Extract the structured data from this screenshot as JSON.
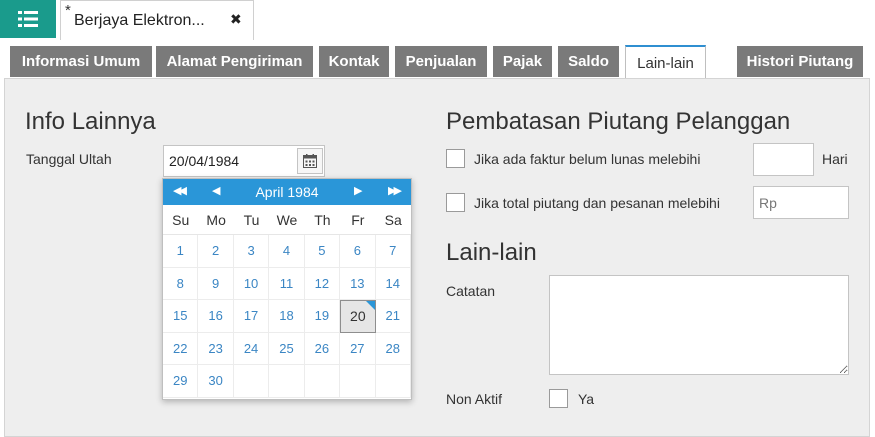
{
  "topbar": {
    "menu_icon": "list-icon",
    "doc_tab": {
      "modified_marker": "*",
      "title": "Berjaya Elektron...",
      "close_glyph": "✖"
    }
  },
  "tabs": [
    {
      "label": "Informasi Umum",
      "active": false
    },
    {
      "label": "Alamat Pengiriman",
      "active": false
    },
    {
      "label": "Kontak",
      "active": false
    },
    {
      "label": "Penjualan",
      "active": false
    },
    {
      "label": "Pajak",
      "active": false
    },
    {
      "label": "Saldo",
      "active": false
    },
    {
      "label": "Lain-lain",
      "active": true
    },
    {
      "label": "Histori Piutang",
      "active": false
    }
  ],
  "info_lainnya": {
    "heading": "Info Lainnya",
    "tanggal_ultah_label": "Tanggal Ultah",
    "tanggal_ultah_value": "20/04/1984"
  },
  "calendar": {
    "month_label": "April 1984",
    "nav": {
      "prev_year": "◀◀",
      "prev_month": "◀",
      "next_month": "▶",
      "next_year": "▶▶"
    },
    "weekdays": [
      "Su",
      "Mo",
      "Tu",
      "We",
      "Th",
      "Fr",
      "Sa"
    ],
    "weeks": [
      [
        "1",
        "2",
        "3",
        "4",
        "5",
        "6",
        "7"
      ],
      [
        "8",
        "9",
        "10",
        "11",
        "12",
        "13",
        "14"
      ],
      [
        "15",
        "16",
        "17",
        "18",
        "19",
        "20",
        "21"
      ],
      [
        "22",
        "23",
        "24",
        "25",
        "26",
        "27",
        "28"
      ],
      [
        "29",
        "30",
        "",
        "",
        "",
        "",
        ""
      ]
    ],
    "selected_day": "20",
    "accent_color": "#2a96d8"
  },
  "pembatasan": {
    "heading": "Pembatasan Piutang Pelanggan",
    "faktur_label": "Jika ada faktur belum lunas melebihi",
    "faktur_value": "",
    "hari_label": "Hari",
    "total_label": "Jika total piutang dan pesanan melebihi",
    "total_placeholder": "Rp"
  },
  "lain_lain": {
    "heading": "Lain-lain",
    "catatan_label": "Catatan",
    "catatan_value": "",
    "non_aktif_label": "Non Aktif",
    "ya_label": "Ya"
  },
  "colors": {
    "teal": "#1a9b8c",
    "tab_gray": "#7a7a7a",
    "blue": "#2a96d8"
  }
}
